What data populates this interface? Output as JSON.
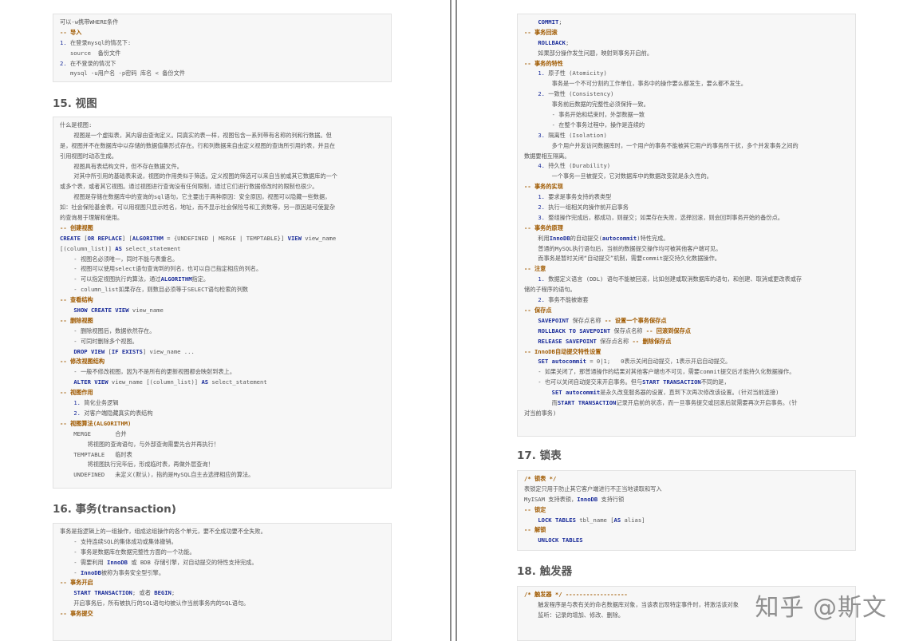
{
  "left": {
    "box1": [
      "可以-w携带WHERE条件",
      "-- 导入",
      "1. 在登录mysql的情况下:",
      "   source  备份文件",
      "2. 在不登录的情况下",
      "   mysql -u用户名 -p密码 库名 < 备份文件"
    ],
    "heading15": "15. 视图",
    "box2": [
      "什么是视图:",
      "    视图是一个虚拟表，其内容由查询定义。同真实的表一样，视图包含一系列带有名称的列和行数据。但",
      "是，视图并不在数据库中以存储的数据值集形式存在。行和列数据来自由定义视图的查询所引用的表，并且在",
      "引用视图时动态生成。",
      "    视图具有表结构文件，但不存在数据文件。",
      "    对其中所引用的基础表来说，视图的作用类似于筛选。定义视图的筛选可以来自当前或其它数据库的一个",
      "或多个表，或者其它视图。通过视图进行查询没有任何限制，通过它们进行数据修改时的限制也很少。",
      "    视图是存储在数据库中的查询的sql语句，它主要出于两种原因：安全原因，视图可以隐藏一些数据，",
      "如：社会保险基金表，可以用视图只显示姓名，地址，而不显示社会保险号和工资数等，另一原因是可使复杂",
      "的查询易于理解和使用。",
      "-- 创建视图",
      "CREATE [OR REPLACE] [ALGORITHM = {UNDEFINED | MERGE | TEMPTABLE}] VIEW view_name",
      "[(column_list)] AS select_statement",
      "    - 视图名必须唯一，同时不能与表重名。",
      "    - 视图可以使用select语句查询到的列名，也可以自己指定相应的列名。",
      "    - 可以指定视图执行的算法，通过ALGORITHM指定。",
      "    - column_list如果存在，则数目必须等于SELECT语句检索的列数",
      "-- 查看结构",
      "    SHOW CREATE VIEW view_name",
      "-- 删除视图",
      "    - 删除视图后，数据依然存在。",
      "    - 可同时删除多个视图。",
      "    DROP VIEW [IF EXISTS] view_name ...",
      "-- 修改视图结构",
      "    - 一般不修改视图，因为不是所有的更新视图都会映射到表上。",
      "    ALTER VIEW view_name [(column_list)] AS select_statement",
      "-- 视图作用",
      "    1. 简化业务逻辑",
      "    2. 对客户端隐藏真实的表结构",
      "-- 视图算法(ALGORITHM)",
      "    MERGE       合并",
      "        将视图的查询语句，与外部查询需要先合并再执行！",
      "    TEMPTABLE   临时表",
      "        将视图执行完毕后，形成临时表，再做外层查询！",
      "    UNDEFINED   未定义(默认)，指的是MySQL自主去选择相应的算法。"
    ],
    "heading16": "16. 事务(transaction)",
    "box3": [
      "事务是指逻辑上的一组操作，组成这组操作的各个单元，要不全成功要不全失败。",
      "    - 支持连续SQL的集体成功或集体撤销。",
      "    - 事务是数据库在数据完整性方面的一个功能。",
      "    - 需要利用 InnoDB 或 BDB 存储引擎，对自动提交的特性支持完成。",
      "    - InnoDB被称为事务安全型引擎。",
      "-- 事务开启",
      "    START TRANSACTION; 或者 BEGIN;",
      "    开启事务后，所有被执行的SQL语句均被认作当前事务内的SQL语句。",
      "-- 事务提交"
    ]
  },
  "right": {
    "box4": [
      "    COMMIT;",
      "-- 事务回滚",
      "    ROLLBACK;",
      "    如果部分操作发生问题，映射到事务开启前。",
      "-- 事务的特性",
      "    1. 原子性 (Atomicity)",
      "        事务是一个不可分割的工作单位，事务中的操作要么都发生，要么都不发生。",
      "    2. 一致性 (Consistency)",
      "        事务前后数据的完整性必须保持一致。",
      "        - 事务开始和结束时，外部数据一致",
      "        - 在整个事务过程中，操作是连续的",
      "    3. 隔离性 (Isolation)",
      "        多个用户并发访问数据库时，一个用户的事务不能被其它用户的事务所干扰，多个并发事务之间的",
      "数据要相互隔离。",
      "    4. 持久性 (Durability)",
      "        一个事务一旦被提交，它对数据库中的数据改变就是永久性的。",
      "-- 事务的实现",
      "    1. 要求是事务支持的表类型",
      "    2. 执行一组相关的操作前开启事务",
      "    3. 整组操作完成后，都成功，则提交；如果存在失败，选择回滚，则会回到事务开始的备份点。",
      "-- 事务的原理",
      "    利用InnoDB的自动提交(autocommit)特性完成。",
      "    普通的MySQL执行语句后，当前的数据提交操作均可被其他客户端可见。",
      "    而事务是暂时关闭“自动提交”机制，需要commit提交持久化数据操作。",
      "-- 注意",
      "    1. 数据定义语言 (DDL) 语句不能被回滚，比如创建或取消数据库的语句，和创建、取消或更改表或存",
      "储的子程序的语句。",
      "    2. 事务不能被嵌套",
      "-- 保存点",
      "    SAVEPOINT 保存点名称 -- 设置一个事务保存点",
      "    ROLLBACK TO SAVEPOINT 保存点名称 -- 回滚到保存点",
      "    RELEASE SAVEPOINT 保存点名称 -- 删除保存点",
      "-- InnoDB自动提交特性设置",
      "    SET autocommit = 0|1;   0表示关闭自动提交，1表示开启自动提交。",
      "    - 如果关闭了，那普通操作的结果对其他客户端也不可见，需要commit提交后才能持久化数据操作。",
      "    - 也可以关闭自动提交来开启事务。但与START TRANSACTION不同的是，",
      "        SET autocommit是永久改变服务器的设置，直到下次再次修改该设置。(针对当前连接)",
      "        而START TRANSACTION记录开启前的状态，而一旦事务提交或回滚后就需要再次开启事务。(针",
      "对当前事务)"
    ],
    "heading17": "17. 锁表",
    "box5": [
      "/* 锁表 */",
      "表锁定只用于防止其它客户端进行不正当地读取和写入",
      "MyISAM 支持表锁，InnoDB 支持行锁",
      "-- 锁定",
      "    LOCK TABLES tbl_name [AS alias]",
      "-- 解锁",
      "    UNLOCK TABLES"
    ],
    "heading18": "18. 触发器",
    "box6": [
      "/* 触发器 */ ------------------",
      "    触发程序是与表有关的命名数据库对象，当该表出现特定事件时，将激活该对象",
      "    监听：记录的增加、修改、删除。"
    ]
  },
  "watermark": "知乎 @斯文"
}
